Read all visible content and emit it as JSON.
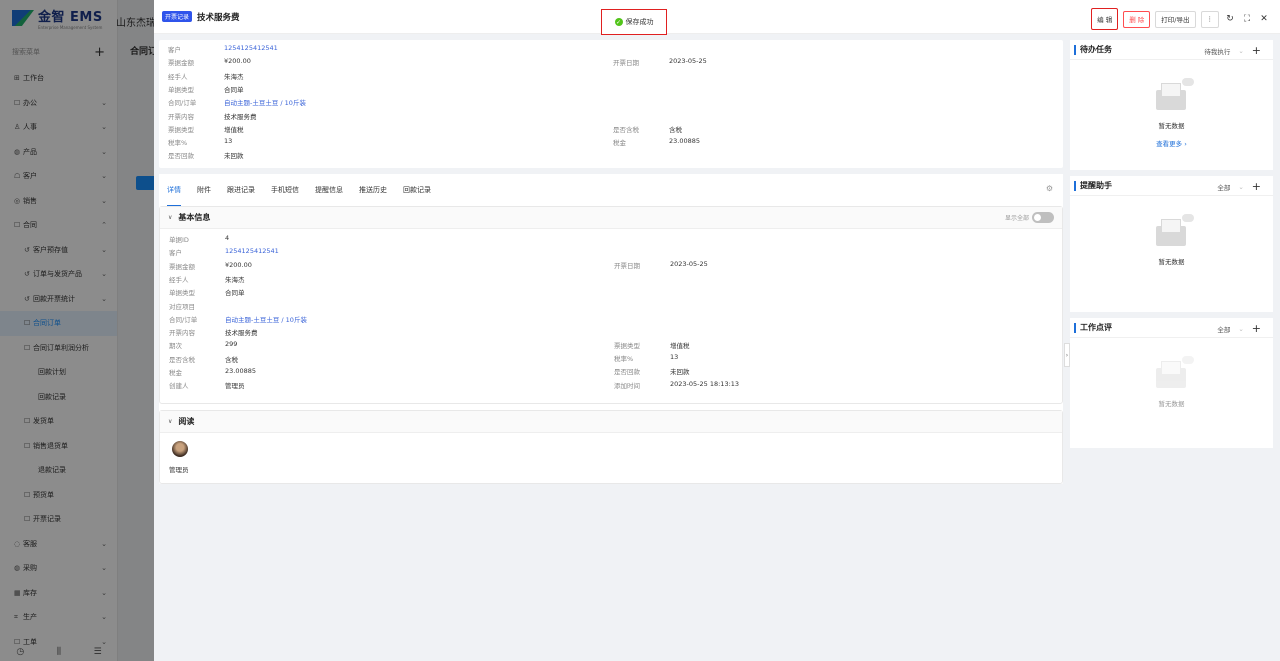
{
  "app": {
    "logo_text": "金智 EMS",
    "logo_sub": "Enterprise Management System",
    "company": "山东杰瑞"
  },
  "sidebar": {
    "search_placeholder": "搜索菜单",
    "items": [
      {
        "label": "工作台",
        "icon": "grid-icon",
        "chev": ""
      },
      {
        "label": "办公",
        "icon": "office-icon",
        "chev": "⌄"
      },
      {
        "label": "人事",
        "icon": "people-icon",
        "chev": "⌄"
      },
      {
        "label": "产品",
        "icon": "product-icon",
        "chev": "⌄"
      },
      {
        "label": "客户",
        "icon": "customer-icon",
        "chev": "⌄"
      },
      {
        "label": "销售",
        "icon": "sales-icon",
        "chev": "⌄"
      },
      {
        "label": "合同",
        "icon": "contract-icon",
        "chev": "⌃"
      },
      {
        "label": "客户预存值",
        "icon": "refresh-icon",
        "chev": "⌄"
      },
      {
        "label": "订单与发货产品",
        "icon": "refresh-icon",
        "chev": "⌄"
      },
      {
        "label": "回款开票统计",
        "icon": "refresh-icon",
        "chev": "⌄"
      },
      {
        "label": "合同订单",
        "icon": "doc-icon",
        "chev": ""
      },
      {
        "label": "合同订单利润分析",
        "icon": "doc-icon",
        "chev": ""
      },
      {
        "label": "回款计划",
        "icon": "",
        "chev": ""
      },
      {
        "label": "回款记录",
        "icon": "",
        "chev": ""
      },
      {
        "label": "发货单",
        "icon": "doc-icon",
        "chev": ""
      },
      {
        "label": "销售退货单",
        "icon": "doc-icon",
        "chev": ""
      },
      {
        "label": "退款记录",
        "icon": "",
        "chev": ""
      },
      {
        "label": "预货单",
        "icon": "doc-icon",
        "chev": ""
      },
      {
        "label": "开票记录",
        "icon": "doc-icon",
        "chev": ""
      },
      {
        "label": "客服",
        "icon": "service-icon",
        "chev": "⌄"
      },
      {
        "label": "采购",
        "icon": "purchase-icon",
        "chev": "⌄"
      },
      {
        "label": "库存",
        "icon": "stock-icon",
        "chev": "⌄"
      },
      {
        "label": "生产",
        "icon": "production-icon",
        "chev": "⌄"
      },
      {
        "label": "工单",
        "icon": "ticket-icon",
        "chev": "⌄"
      }
    ],
    "bg_title": "合同订"
  },
  "drawer": {
    "tag": "开票记录",
    "title": "技术服务费",
    "toast": "保存成功",
    "buttons": {
      "edit": "编 辑",
      "delete": "删 除",
      "print": "打印/导出"
    }
  },
  "summary": {
    "left": [
      {
        "label": "客户",
        "value": "1254125412541",
        "link": true
      },
      {
        "label": "票据金额",
        "value": "¥200.00",
        "link": false
      },
      {
        "label": "经手人",
        "value": "朱海杰",
        "link": false
      },
      {
        "label": "单据类型",
        "value": "合同单",
        "link": false
      },
      {
        "label": "合同/订单",
        "value": "自动主题-土豆土豆 / 10斤装",
        "link": true
      },
      {
        "label": "开票内容",
        "value": "技术服务费",
        "link": false
      },
      {
        "label": "票据类型",
        "value": "增值税",
        "link": false
      },
      {
        "label": "税率%",
        "value": "13",
        "link": false
      },
      {
        "label": "是否回款",
        "value": "未回款",
        "link": false
      }
    ],
    "right": [
      {
        "label": "开票日期",
        "value": "2023-05-25"
      },
      {
        "label": "是否含税",
        "value": "含税"
      },
      {
        "label": "税金",
        "value": "23.00885"
      }
    ]
  },
  "tabs": [
    "详情",
    "附件",
    "跟进记录",
    "手机短信",
    "提醒信息",
    "推送历史",
    "回款记录"
  ],
  "basic": {
    "title": "基本信息",
    "show_all": "显示全部",
    "left": [
      {
        "label": "单据ID",
        "value": "4",
        "link": false
      },
      {
        "label": "客户",
        "value": "1254125412541",
        "link": true
      },
      {
        "label": "票据金额",
        "value": "¥200.00",
        "link": false
      },
      {
        "label": "经手人",
        "value": "朱海杰",
        "link": false
      },
      {
        "label": "单据类型",
        "value": "合同单",
        "link": false
      },
      {
        "label": "对应项目",
        "value": "",
        "link": false
      },
      {
        "label": "合同/订单",
        "value": "自动主题-土豆土豆 / 10斤装",
        "link": true
      },
      {
        "label": "开票内容",
        "value": "技术服务费",
        "link": false
      },
      {
        "label": "期次",
        "value": "299",
        "link": false
      },
      {
        "label": "是否含税",
        "value": "含税",
        "link": false
      },
      {
        "label": "税金",
        "value": "23.00885",
        "link": false
      },
      {
        "label": "创建人",
        "value": "管理员",
        "link": false
      }
    ],
    "right": [
      {
        "label": "开票日期",
        "value": "2023-05-25"
      },
      {
        "label": "票据类型",
        "value": "增值税"
      },
      {
        "label": "税率%",
        "value": "13"
      },
      {
        "label": "是否回款",
        "value": "未回款"
      },
      {
        "label": "添加时间",
        "value": "2023-05-25 18:13:13"
      }
    ]
  },
  "read": {
    "title": "阅读",
    "user": "管理员"
  },
  "panels": [
    {
      "title": "待办任务",
      "filter": "待我执行",
      "empty": "暂无数据",
      "more": "查看更多 ›"
    },
    {
      "title": "提醒助手",
      "filter": "全部",
      "empty": "暂无数据",
      "more": ""
    },
    {
      "title": "工作点评",
      "filter": "全部",
      "empty": "暂无数据",
      "more": ""
    }
  ]
}
